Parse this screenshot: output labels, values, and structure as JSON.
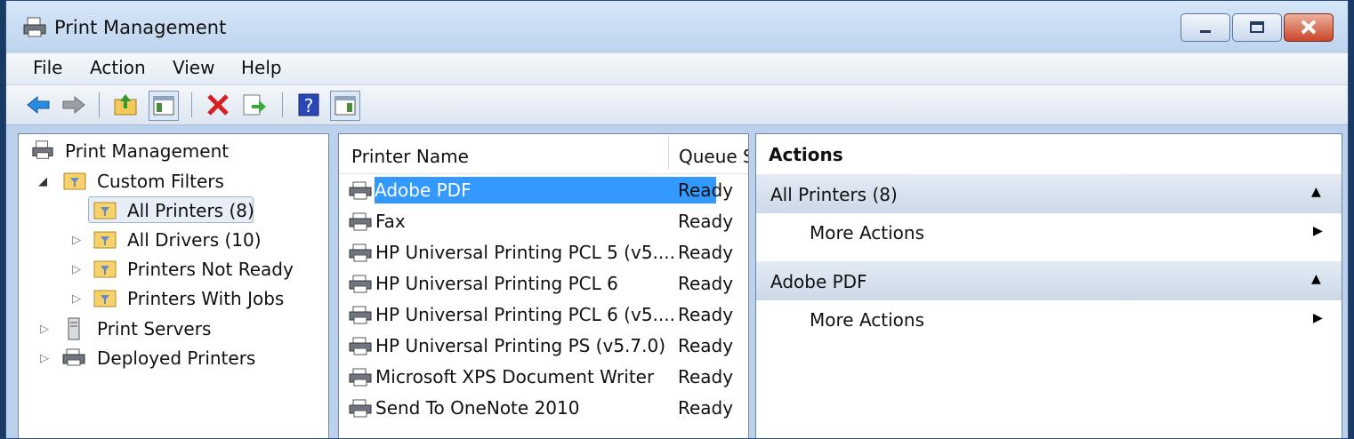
{
  "window": {
    "title": "Print Management"
  },
  "menu": [
    "File",
    "Action",
    "View",
    "Help"
  ],
  "toolbar_icons": [
    "back-icon",
    "forward-icon",
    "up-folder-icon",
    "show-hide-tree-icon",
    "delete-icon",
    "export-list-icon",
    "help-icon",
    "show-hide-action-pane-icon"
  ],
  "tree": {
    "root": "Print Management",
    "custom_filters": "Custom Filters",
    "all_printers": "All Printers (8)",
    "all_drivers": "All Drivers (10)",
    "printers_not_ready": "Printers Not Ready",
    "printers_with_jobs": "Printers With Jobs",
    "print_servers": "Print Servers",
    "deployed_printers": "Deployed Printers"
  },
  "list": {
    "columns": [
      "Printer Name",
      "Queue S"
    ],
    "rows": [
      {
        "name": "Adobe PDF",
        "status": "Ready"
      },
      {
        "name": "Fax",
        "status": "Ready"
      },
      {
        "name": "HP Universal Printing PCL 5 (v5....",
        "status": "Ready"
      },
      {
        "name": "HP Universal Printing PCL 6",
        "status": "Ready"
      },
      {
        "name": "HP Universal Printing PCL 6 (v5....",
        "status": "Ready"
      },
      {
        "name": "HP Universal Printing PS (v5.7.0)",
        "status": "Ready"
      },
      {
        "name": "Microsoft XPS Document Writer",
        "status": "Ready"
      },
      {
        "name": "Send To OneNote 2010",
        "status": "Ready"
      }
    ]
  },
  "actions": {
    "title": "Actions",
    "groups": [
      {
        "label": "All Printers (8)",
        "item": "More Actions"
      },
      {
        "label": "Adobe PDF",
        "item": "More Actions"
      }
    ]
  }
}
